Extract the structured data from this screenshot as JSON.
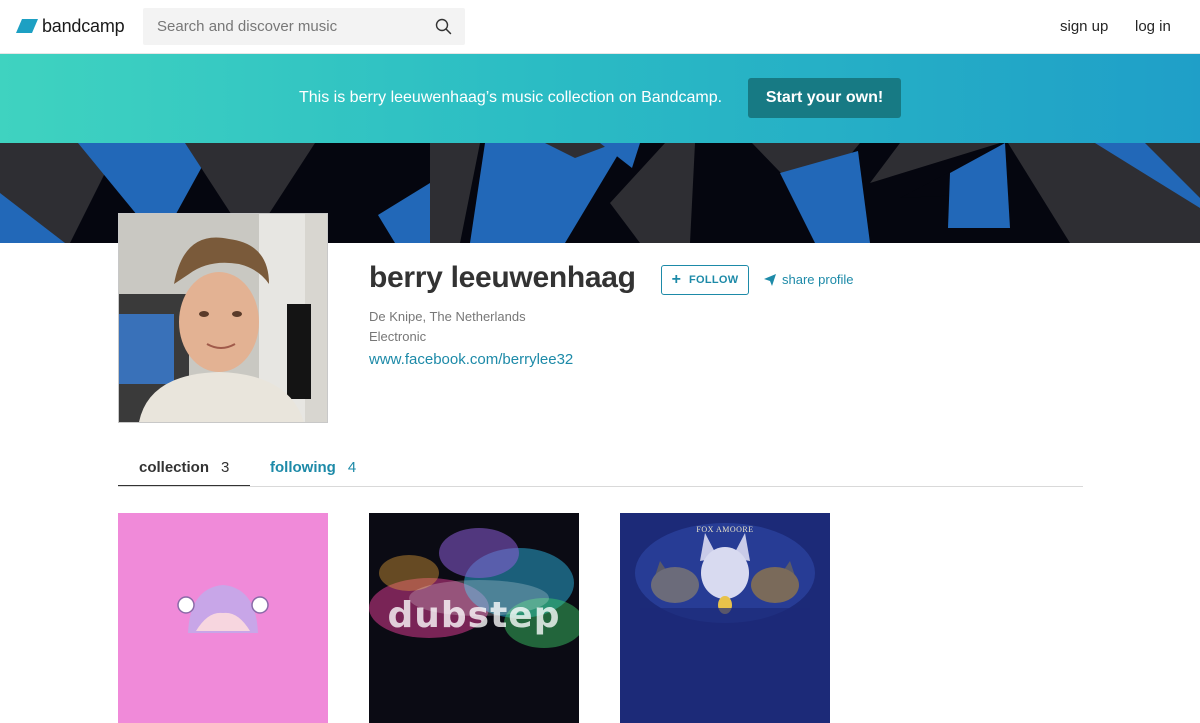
{
  "header": {
    "logo_text": "bandcamp",
    "search_placeholder": "Search and discover music",
    "signup_label": "sign up",
    "login_label": "log in"
  },
  "banner": {
    "text": "This is berry leeuwenhaag’s music collection on Bandcamp.",
    "button_label": "Start your own!"
  },
  "profile": {
    "name": "berry leeuwenhaag",
    "follow_label": "FOLLOW",
    "share_label": "share profile",
    "location": "De Knipe, The Netherlands",
    "genre": "Electronic",
    "website": "www.facebook.com/berrylee32"
  },
  "tabs": [
    {
      "label": "collection",
      "count": "3",
      "active": true
    },
    {
      "label": "following",
      "count": "4",
      "active": false
    }
  ],
  "collection": [
    {
      "art": "pink anime character artwork"
    },
    {
      "art": "dubstep colorful smoke artwork",
      "art_text": "dubstep"
    },
    {
      "art": "wolves fantasy artwork",
      "art_text": "FOX AMOORE"
    }
  ],
  "colors": {
    "accent": "#1d8aa8",
    "banner_start": "#3fd3c0",
    "banner_end": "#1f9fc8",
    "banner_button": "#177a84",
    "cover_blue": "#2268b8",
    "cover_dark": "#05060f"
  },
  "icons": {
    "logo": "bandcamp-logo-icon",
    "search": "search-icon",
    "follow": "plus-icon",
    "share": "paper-plane-icon"
  }
}
